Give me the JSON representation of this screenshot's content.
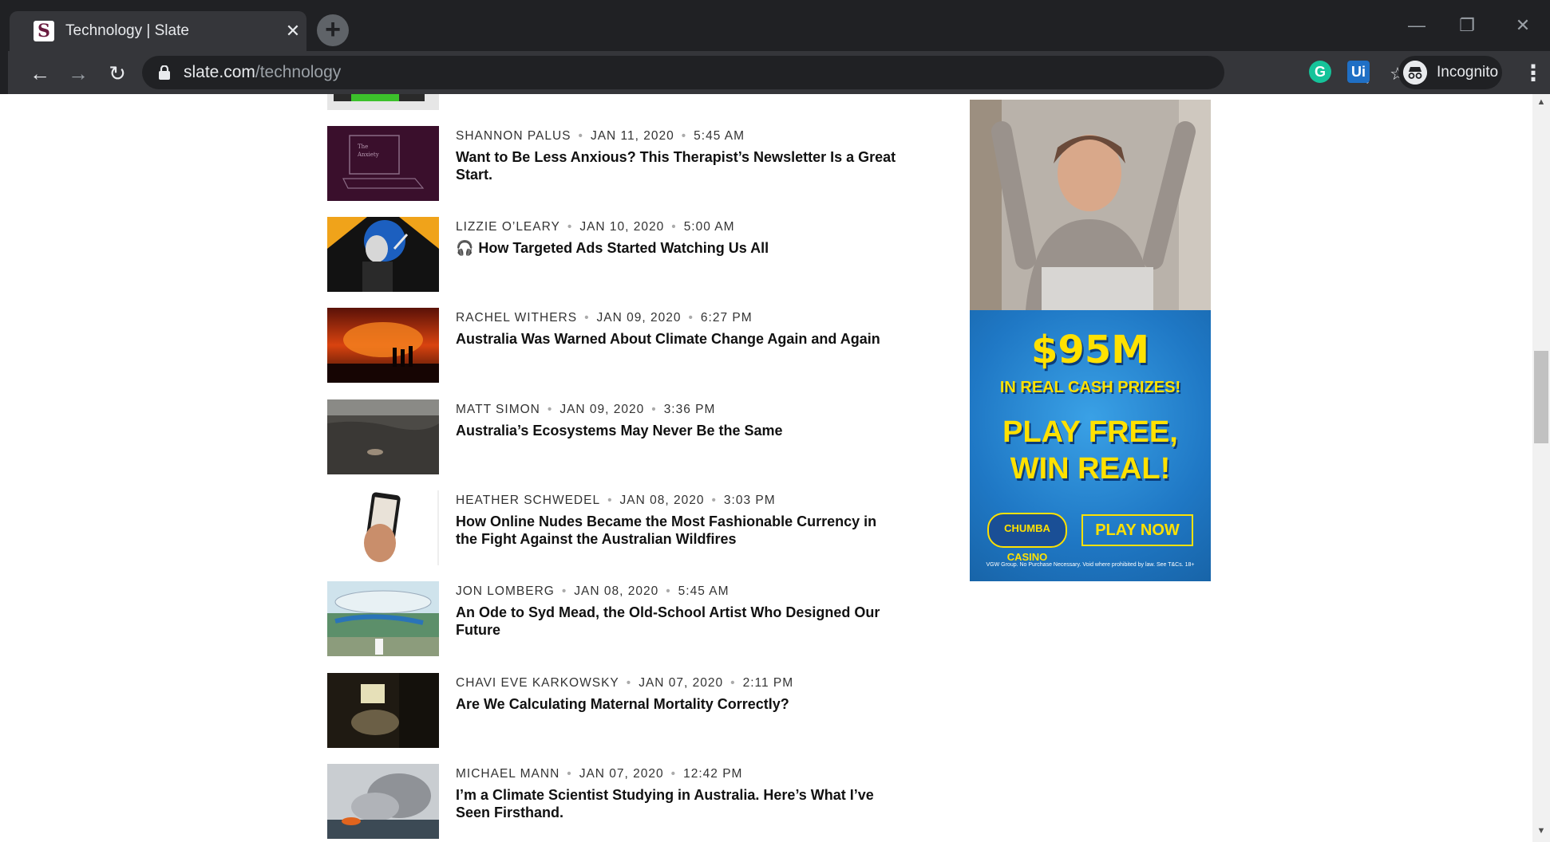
{
  "browser": {
    "tab_title": "Technology | Slate",
    "tab_close": "✕",
    "favicon_letter": "S",
    "url_host": "slate.com",
    "url_path": "/technology",
    "incognito_label": "Incognito",
    "extension_grammarly": "G",
    "extension_ui": "Ui"
  },
  "articles": [
    {
      "author": "SHANNON PALUS",
      "date": "JAN 11, 2020",
      "time": "5:45 AM",
      "headline": "Want to Be Less Anxious? This Therapist’s Newsletter Is a Great Start.",
      "podcast": false
    },
    {
      "author": "LIZZIE O’LEARY",
      "date": "JAN 10, 2020",
      "time": "5:00 AM",
      "headline": "How Targeted Ads Started Watching Us All",
      "podcast": true
    },
    {
      "author": "RACHEL WITHERS",
      "date": "JAN 09, 2020",
      "time": "6:27 PM",
      "headline": "Australia Was Warned About Climate Change Again and Again",
      "podcast": false
    },
    {
      "author": "MATT SIMON",
      "date": "JAN 09, 2020",
      "time": "3:36 PM",
      "headline": "Australia’s Ecosystems May Never Be the Same",
      "podcast": false
    },
    {
      "author": "HEATHER SCHWEDEL",
      "date": "JAN 08, 2020",
      "time": "3:03 PM",
      "headline": "How Online Nudes Became the Most Fashionable Currency in the Fight Against the Australian Wildfires",
      "podcast": false
    },
    {
      "author": "JON LOMBERG",
      "date": "JAN 08, 2020",
      "time": "5:45 AM",
      "headline": "An Ode to Syd Mead, the Old-School Artist Who Designed Our Future",
      "podcast": false
    },
    {
      "author": "CHAVI EVE KARKOWSKY",
      "date": "JAN 07, 2020",
      "time": "2:11 PM",
      "headline": "Are We Calculating Maternal Mortality Correctly?",
      "podcast": false
    },
    {
      "author": "MICHAEL MANN",
      "date": "JAN 07, 2020",
      "time": "12:42 PM",
      "headline": "I’m a Climate Scientist Studying in Australia. Here’s What I’ve Seen Firsthand.",
      "podcast": false
    }
  ],
  "ad": {
    "amount": "$95M",
    "prizes": "IN REAL CASH PRIZES!",
    "play_line1": "PLAY FREE,",
    "play_line2": "WIN REAL!",
    "logo_text": "CHUMBA CASINO",
    "cta": "PLAY NOW",
    "fine_print": "VGW Group. No Purchase Necessary. Void where prohibited by law. See T&Cs. 18+"
  }
}
